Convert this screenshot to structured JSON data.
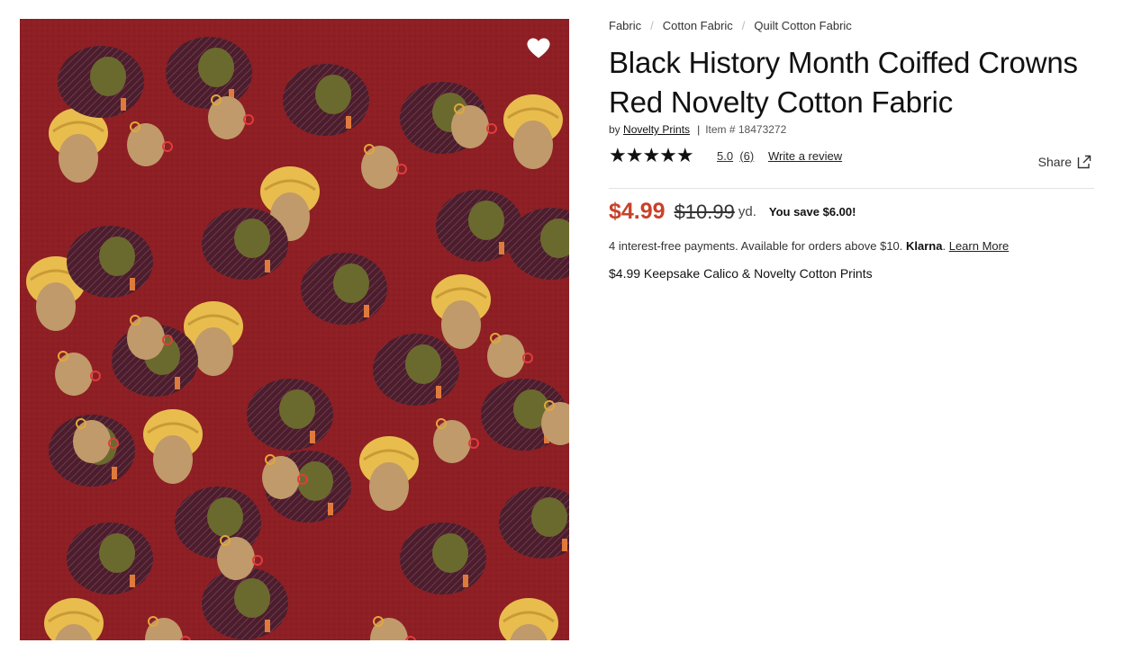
{
  "breadcrumb": [
    "Fabric",
    "Cotton Fabric",
    "Quilt Cotton Fabric"
  ],
  "product": {
    "title_line1": "Black History Month Coiffed Crowns",
    "title_line2": "Red Novelty Cotton Fabric",
    "by_label": "by",
    "brand": "Novelty Prints",
    "item_label": "Item # 18473272",
    "image_alt": "Red fabric with women wearing headwraps pattern"
  },
  "rating": {
    "stars": "★★★★★",
    "score": "5.0",
    "count": "(6)",
    "write_review": "Write a review"
  },
  "share": {
    "label": "Share"
  },
  "price": {
    "sale": "$4.99",
    "original": "$10.99",
    "unit": "yd.",
    "savings": "You save $6.00!"
  },
  "klarna": {
    "text": "4 interest-free payments. Available for orders above $10.",
    "brand": "Klarna",
    "link": "Learn More"
  },
  "promo": "$4.99 Keepsake Calico & Novelty Cotton Prints",
  "colors": {
    "accent_price": "#c8412a",
    "fabric_bg": "#8e1f24",
    "headwrap_yellow": "#e8bd4e",
    "headwrap_olive": "#6b6a2e",
    "face_tan": "#c09a6a"
  },
  "icons": [
    "heart-icon",
    "star-icon",
    "share-external-icon"
  ]
}
